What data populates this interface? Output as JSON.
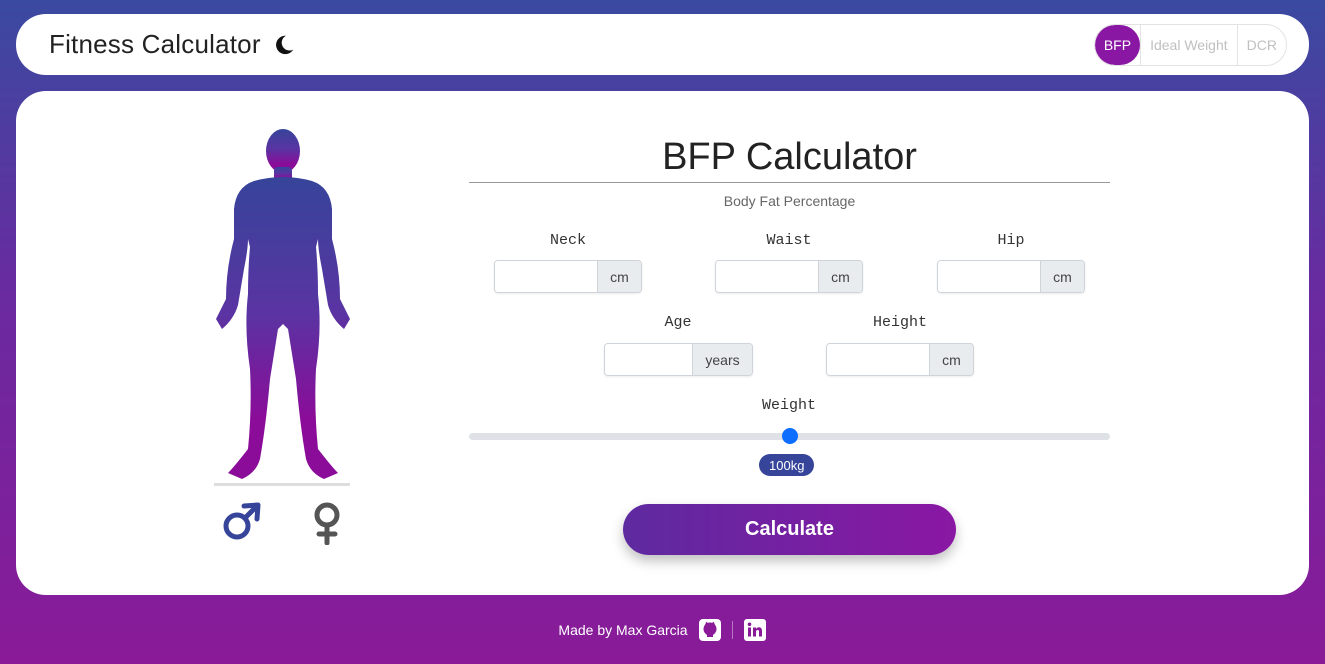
{
  "header": {
    "title": "Fitness Calculator",
    "theme_icon": "moon-icon",
    "tabs": [
      {
        "label": "BFP",
        "active": true
      },
      {
        "label": "Ideal Weight",
        "active": false
      },
      {
        "label": "DCR",
        "active": false
      }
    ]
  },
  "calculator": {
    "title": "BFP Calculator",
    "subtitle": "Body Fat Percentage",
    "fields": {
      "neck": {
        "label": "Neck",
        "unit": "cm",
        "value": ""
      },
      "waist": {
        "label": "Waist",
        "unit": "cm",
        "value": ""
      },
      "hip": {
        "label": "Hip",
        "unit": "cm",
        "value": ""
      },
      "age": {
        "label": "Age",
        "unit": "years",
        "value": ""
      },
      "height": {
        "label": "Height",
        "unit": "cm",
        "value": ""
      }
    },
    "weight": {
      "label": "Weight",
      "value_label": "100kg",
      "fraction": 0.5
    },
    "button_label": "Calculate"
  },
  "gender": {
    "male_icon": "male-symbol-icon",
    "female_icon": "female-symbol-icon",
    "selected": "male"
  },
  "footer": {
    "credit": "Made by Max Garcia",
    "icons": [
      "github-icon",
      "linkedin-icon"
    ]
  },
  "colors": {
    "accent": "#8a17a3",
    "primary_blue": "#36449a",
    "slider_thumb": "#0d6efd"
  }
}
